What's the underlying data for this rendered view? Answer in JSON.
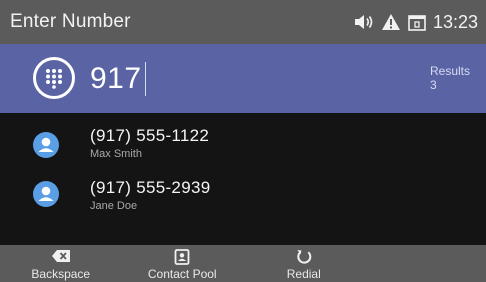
{
  "status": {
    "title": "Enter Number",
    "time": "13:23",
    "icons": [
      "speaker-volume-icon",
      "warning-icon",
      "window-icon"
    ]
  },
  "entry": {
    "keypad_icon": "keypad-icon",
    "number": "917",
    "results_label": "Results",
    "results_count": "3"
  },
  "contacts": [
    {
      "number": "(917) 555-1122",
      "name": "Max Smith",
      "icon": "user-avatar-icon"
    },
    {
      "number": "(917) 555-2939",
      "name": "Jane Doe",
      "icon": "user-avatar-icon"
    }
  ],
  "softkeys": [
    {
      "label": "Backspace",
      "icon": "backspace-icon"
    },
    {
      "label": "Contact Pool",
      "icon": "contact-card-icon"
    },
    {
      "label": "Redial",
      "icon": "redial-icon"
    },
    {
      "label": "",
      "icon": ""
    }
  ],
  "colors": {
    "status_bar": "#5b5b5b",
    "entry_bar": "#5a64a4",
    "list_bg": "#141414",
    "avatar": "#5a9ee6"
  }
}
